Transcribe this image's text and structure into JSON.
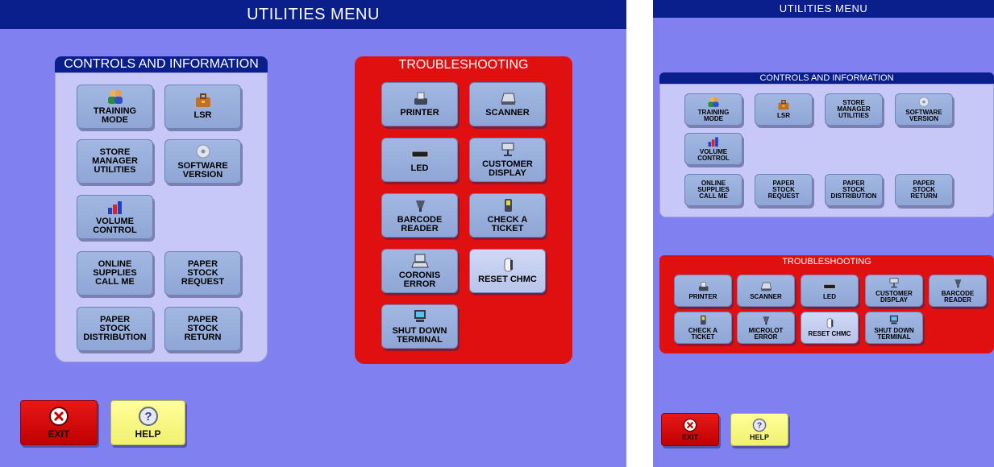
{
  "title": "UTILITIES MENU",
  "controls_header": "CONTROLS AND INFORMATION",
  "troubleshooting_header": "TROUBLESHOOTING",
  "screen1": {
    "controls": [
      {
        "label": "TRAINING\nMODE",
        "icon": "people-icon"
      },
      {
        "label": "LSR",
        "icon": "briefcase-icon"
      },
      {
        "label": "STORE\nMANAGER\nUTILITIES",
        "icon": ""
      },
      {
        "label": "SOFTWARE\nVERSION",
        "icon": "disc-icon"
      },
      {
        "label": "VOLUME\nCONTROL",
        "icon": "bar-chart-icon"
      },
      {
        "label": "ONLINE\nSUPPLIES\nCALL ME",
        "icon": ""
      },
      {
        "label": "PAPER\nSTOCK\nREQUEST",
        "icon": ""
      },
      {
        "label": "PAPER\nSTOCK\nDISTRIBUTION",
        "icon": ""
      },
      {
        "label": "PAPER\nSTOCK\nRETURN",
        "icon": ""
      }
    ],
    "troubleshooting": [
      {
        "label": "PRINTER",
        "icon": "printer-icon"
      },
      {
        "label": "SCANNER",
        "icon": "scanner-icon"
      },
      {
        "label": "LED",
        "icon": "led-icon"
      },
      {
        "label": "CUSTOMER\nDISPLAY",
        "icon": "monitor-icon"
      },
      {
        "label": "BARCODE\nREADER",
        "icon": "barcode-reader-icon"
      },
      {
        "label": "CHECK A\nTICKET",
        "icon": "ticket-checker-icon"
      },
      {
        "label": "CORONIS\nERROR",
        "icon": "terminal-icon"
      },
      {
        "label": "RESET CHMC",
        "icon": "chmc-device-icon"
      },
      {
        "label": "SHUT DOWN\nTERMINAL",
        "icon": "computer-icon"
      }
    ]
  },
  "screen2": {
    "controls": [
      {
        "label": "TRAINING\nMODE",
        "icon": "people-icon"
      },
      {
        "label": "LSR",
        "icon": "briefcase-icon"
      },
      {
        "label": "STORE\nMANAGER\nUTILITIES",
        "icon": ""
      },
      {
        "label": "SOFTWARE\nVERSION",
        "icon": "disc-icon"
      },
      {
        "label": "VOLUME\nCONTROL",
        "icon": "bar-chart-icon"
      },
      {
        "label": "ONLINE\nSUPPLIES\nCALL ME",
        "icon": ""
      },
      {
        "label": "PAPER\nSTOCK\nREQUEST",
        "icon": ""
      },
      {
        "label": "PAPER\nSTOCK\nDISTRIBUTION",
        "icon": ""
      },
      {
        "label": "PAPER\nSTOCK\nRETURN",
        "icon": ""
      }
    ],
    "troubleshooting": [
      {
        "label": "PRINTER",
        "icon": "printer-icon"
      },
      {
        "label": "SCANNER",
        "icon": "scanner-icon"
      },
      {
        "label": "LED",
        "icon": "led-icon"
      },
      {
        "label": "CUSTOMER\nDISPLAY",
        "icon": "monitor-icon"
      },
      {
        "label": "BARCODE\nREADER",
        "icon": "barcode-reader-icon"
      },
      {
        "label": "CHECK A\nTICKET",
        "icon": "ticket-checker-icon"
      },
      {
        "label": "MICROLOT\nERROR",
        "icon": "barcode-reader-icon"
      },
      {
        "label": "RESET CHMC",
        "icon": "chmc-device-icon"
      },
      {
        "label": "SHUT DOWN\nTERMINAL",
        "icon": "computer-icon"
      }
    ]
  },
  "exit_label": "EXIT",
  "help_label": "HELP",
  "colors": {
    "background": "#8080f0",
    "title_bar": "#0a1e8c",
    "controls_panel": "#c8c8f8",
    "troubleshooting_panel": "#e01010",
    "button": "#96acd9",
    "exit": "#e01010",
    "help": "#ffff88"
  }
}
